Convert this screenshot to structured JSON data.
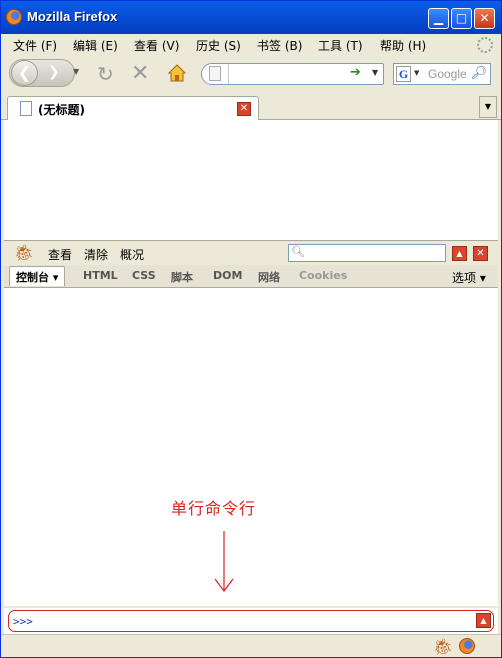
{
  "window": {
    "title": "Mozilla Firefox"
  },
  "menubar": {
    "items": [
      "文件 (F)",
      "编辑 (E)",
      "查看 (V)",
      "历史 (S)",
      "书签 (B)",
      "工具 (T)",
      "帮助 (H)"
    ]
  },
  "navbar": {
    "url_value": "",
    "search_placeholder": "Google",
    "search_engine_letter": "G"
  },
  "tabs": [
    {
      "label": "(无标题)"
    }
  ],
  "firebug": {
    "toolbar": {
      "inspect": "查看",
      "clear": "清除",
      "profile": "概况"
    },
    "panels": [
      {
        "label": "控制台 ▾",
        "state": "active"
      },
      {
        "label": "HTML",
        "state": "normal"
      },
      {
        "label": "CSS",
        "state": "normal"
      },
      {
        "label": "脚本",
        "state": "normal"
      },
      {
        "label": "DOM",
        "state": "normal"
      },
      {
        "label": "网络",
        "state": "normal"
      },
      {
        "label": "Cookies",
        "state": "disabled"
      }
    ],
    "options": "选项 ▾",
    "command_prompt": ">>>"
  },
  "annotation": {
    "text": "单行命令行",
    "color": "#d8231f"
  },
  "colors": {
    "title_bar": "#0a4fd8",
    "chrome": "#ece9d8",
    "close_red": "#d9442d"
  }
}
